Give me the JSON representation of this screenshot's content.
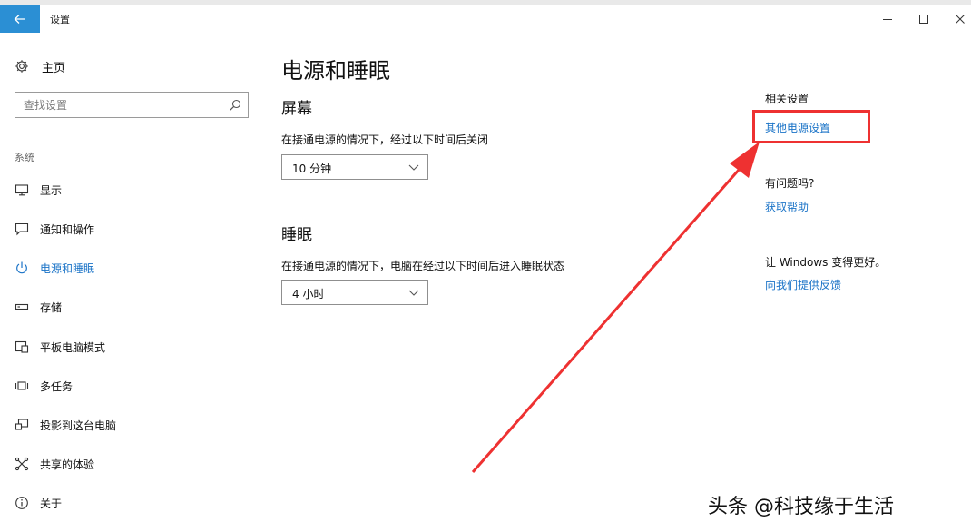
{
  "window": {
    "title": "设置",
    "controls": [
      "minimize-icon",
      "maximize-icon",
      "close-icon"
    ]
  },
  "sidebar": {
    "home_label": "主页",
    "search_placeholder": "查找设置",
    "section_label": "系统",
    "items": [
      {
        "label": "显示",
        "icon": "display-icon",
        "active": false
      },
      {
        "label": "通知和操作",
        "icon": "notification-icon",
        "active": false
      },
      {
        "label": "电源和睡眠",
        "icon": "power-icon",
        "active": true
      },
      {
        "label": "存储",
        "icon": "storage-icon",
        "active": false
      },
      {
        "label": "平板电脑模式",
        "icon": "tablet-mode-icon",
        "active": false
      },
      {
        "label": "多任务",
        "icon": "multitasking-icon",
        "active": false
      },
      {
        "label": "投影到这台电脑",
        "icon": "project-icon",
        "active": false
      },
      {
        "label": "共享的体验",
        "icon": "shared-experience-icon",
        "active": false
      },
      {
        "label": "关于",
        "icon": "info-icon",
        "active": false
      }
    ]
  },
  "main": {
    "page_title": "电源和睡眠",
    "screen": {
      "title": "屏幕",
      "description": "在接通电源的情况下，经过以下时间后关闭",
      "selected": "10 分钟"
    },
    "sleep": {
      "title": "睡眠",
      "description": "在接通电源的情况下，电脑在经过以下时间后进入睡眠状态",
      "selected": "4 小时"
    }
  },
  "related": {
    "heading": "相关设置",
    "link": "其他电源设置",
    "question_heading": "有问题吗?",
    "help_link": "获取帮助",
    "feedback_heading": "让 Windows 变得更好。",
    "feedback_link": "向我们提供反馈"
  },
  "annotation": {
    "highlight_color": "#ee3131"
  },
  "watermark": "头条 @科技缘于生活",
  "colors": {
    "accent": "#2b8fd4",
    "link": "#1a73c7"
  }
}
